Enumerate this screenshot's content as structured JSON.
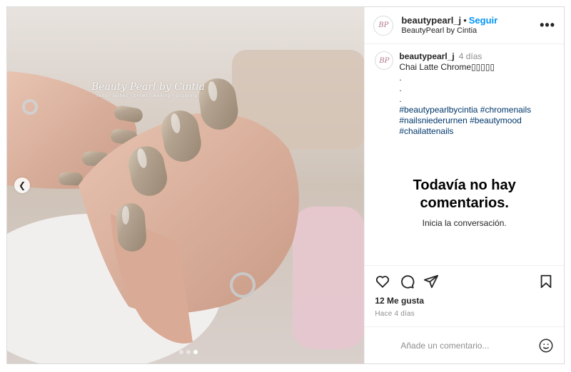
{
  "media": {
    "watermark_title": "Beauty Pearl by Cintia",
    "watermark_sub": "nails · lashes · brows · waxing · sugaring",
    "prev_icon": "chevron-left-icon",
    "carousel": {
      "count": 3,
      "active_index": 2
    }
  },
  "header": {
    "avatar_initials": "BP",
    "username": "beautypearl_j",
    "separator": "•",
    "follow_label": "Seguir",
    "subtitle": "BeautyPearl by Cintia",
    "more_label": "•••"
  },
  "caption": {
    "avatar_initials": "BP",
    "username": "beautypearl_j",
    "time_ago": "4 días",
    "text": "Chai Latte Chrome▯▯▯▯▯",
    "dot_lines": [
      ".",
      ".",
      "."
    ],
    "hashtag_lines": [
      "#beautypearlbycintia #chromenails",
      "#nailsniederurnen #beautymood",
      "#chailattenails"
    ]
  },
  "empty_state": {
    "title_line1": "Todavía no hay",
    "title_line2": "comentarios.",
    "subtitle": "Inicia la conversación."
  },
  "actions": {
    "icons": [
      "heart-icon",
      "comment-icon",
      "share-icon",
      "bookmark-icon"
    ],
    "likes": "12 Me gusta",
    "timestamp": "Hace 4 días"
  },
  "comment_box": {
    "placeholder": "Añade un comentario...",
    "emoji_icon": "emoji-icon"
  },
  "colors": {
    "link_blue": "#0095f6",
    "hashtag": "#00376b",
    "muted": "#8e8e8e",
    "border": "#dbdbdb",
    "nail_polish": "#b3a390"
  }
}
